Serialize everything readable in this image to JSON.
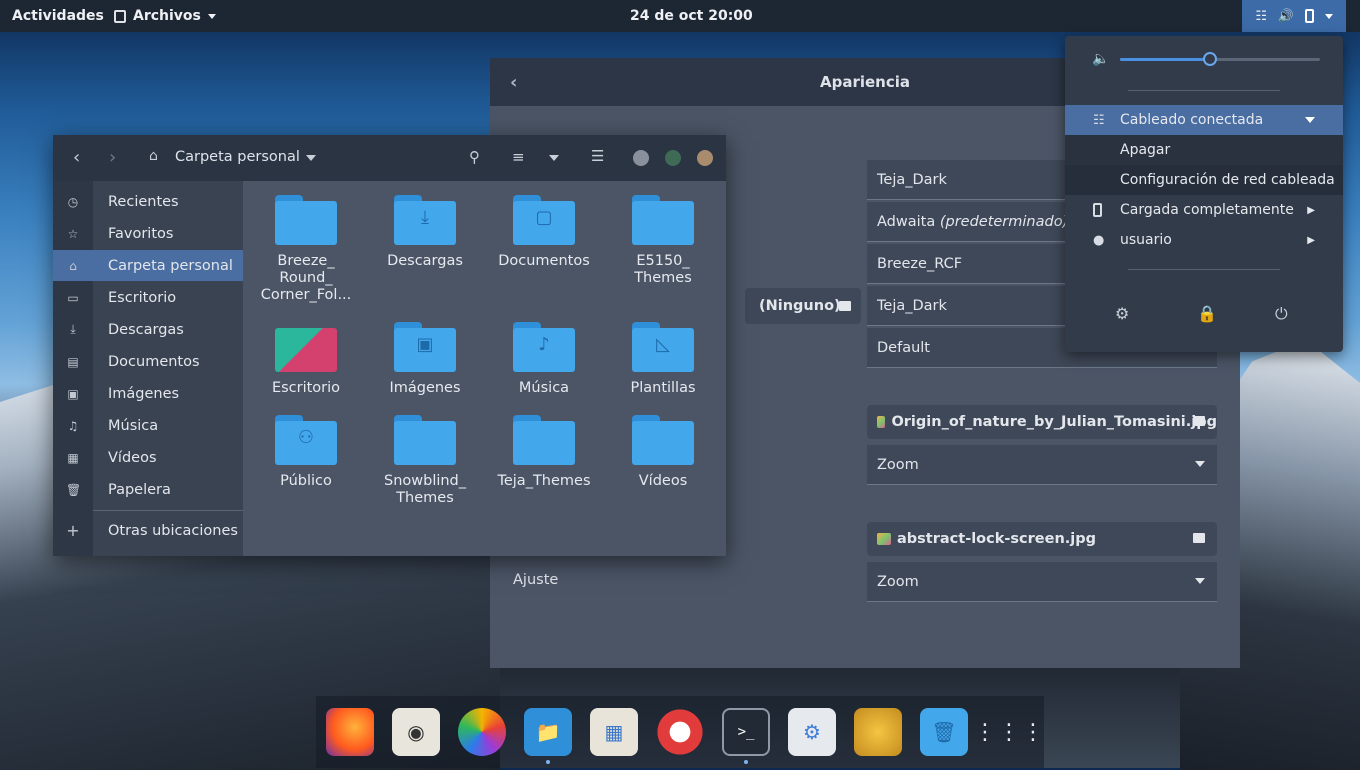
{
  "topbar": {
    "activities": "Actividades",
    "app_name": "Archivos",
    "clock": "24 de oct  20:00",
    "tray_icons": [
      "network-wired-icon",
      "volume-icon",
      "battery-icon",
      "chevron-down-icon"
    ]
  },
  "appearance": {
    "title": "Apariencia",
    "combos": [
      "Teja_Dark",
      "Adwaita",
      "Breeze_RCF",
      "Teja_Dark",
      "Default"
    ],
    "adwaita_suffix": "(predeterminado)",
    "icons_button": "(Ninguno)",
    "background_file": "Origin_of_nature_by_Julian_Tomasini.jpg",
    "background_zoom": "Zoom",
    "lock_file": "abstract-lock-screen.jpg",
    "lock_zoom": "Zoom",
    "ajuste_label": "Ajuste"
  },
  "files": {
    "location": "Carpeta personal",
    "sidebar": [
      {
        "label": "Recientes",
        "icon": "clock-icon"
      },
      {
        "label": "Favoritos",
        "icon": "star-icon"
      },
      {
        "label": "Carpeta personal",
        "icon": "home-icon"
      },
      {
        "label": "Escritorio",
        "icon": "desktop-icon"
      },
      {
        "label": "Descargas",
        "icon": "download-icon"
      },
      {
        "label": "Documentos",
        "icon": "document-icon"
      },
      {
        "label": "Imágenes",
        "icon": "image-icon"
      },
      {
        "label": "Música",
        "icon": "music-icon"
      },
      {
        "label": "Vídeos",
        "icon": "video-icon"
      },
      {
        "label": "Papelera",
        "icon": "trash-icon"
      }
    ],
    "other_locations": "Otras ubicaciones",
    "items": [
      {
        "l1": "Breeze_",
        "l2": "Round_",
        "l3": "Corner_Fol..."
      },
      {
        "l1": "Descargas",
        "l2": "",
        "l3": ""
      },
      {
        "l1": "Documentos",
        "l2": "",
        "l3": ""
      },
      {
        "l1": "E5150_",
        "l2": "Themes",
        "l3": ""
      },
      {
        "l1": "Escritorio",
        "l2": "",
        "l3": ""
      },
      {
        "l1": "Imágenes",
        "l2": "",
        "l3": ""
      },
      {
        "l1": "Música",
        "l2": "",
        "l3": ""
      },
      {
        "l1": "Plantillas",
        "l2": "",
        "l3": ""
      },
      {
        "l1": "Público",
        "l2": "",
        "l3": ""
      },
      {
        "l1": "Snowblind_",
        "l2": "Themes",
        "l3": ""
      },
      {
        "l1": "Teja_Themes",
        "l2": "",
        "l3": ""
      },
      {
        "l1": "Vídeos",
        "l2": "",
        "l3": ""
      }
    ],
    "window_dots": [
      "#8a919c",
      "#3f6a55",
      "#a98c6e"
    ]
  },
  "popup": {
    "volume_level": 0.45,
    "wired": "Cableado conectada",
    "turn_off": "Apagar",
    "wired_settings": "Configuración de red cableada",
    "battery": "Cargada completamente",
    "user": "usuario"
  },
  "colors": {
    "accent": "#4a6da2",
    "topbar": "#1d2633",
    "folder": "#43a7ec"
  }
}
